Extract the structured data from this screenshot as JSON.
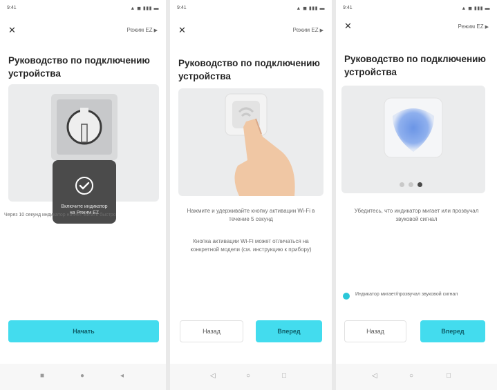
{
  "screens": [
    {
      "status_time": "9:41",
      "status_icons": "▲ ◼ ▮▮▮ ▬",
      "mode_label": "Режим EZ",
      "title": "Руководство по подключению устройства",
      "caption": "Через 10 секунд индикатор начнет мигать быстро",
      "overlay_text": "Включите индикатор на Режим EZ",
      "next_button": "Начать"
    },
    {
      "status_time": "9:41",
      "status_icons": "▲ ◼ ▮▮▮ ▬",
      "mode_label": "Режим EZ",
      "title": "Руководство по подключению устройства",
      "caption_1": "Нажмите и удерживайте кнопку активации Wi-Fi в течение 5 секунд",
      "caption_2": "Кнопка активации Wi-Fi может отличаться на конкретной модели (см. инструкцию к прибору)",
      "back_button": "Назад",
      "next_button": "Вперед"
    },
    {
      "status_time": "9:41",
      "status_icons": "▲ ◼ ▮▮▮ ▬",
      "mode_label": "Режим EZ",
      "title": "Руководство по подключению устройства",
      "caption": "Убедитесь, что индикатор мигает или прозвучал звуковой сигнал",
      "checkbox_label": "Индикатор мигает/прозвучал звуковой сигнал",
      "checkbox_checked": true,
      "pager": {
        "count": 3,
        "active": 3
      },
      "back_button": "Назад",
      "next_button": "Вперед"
    }
  ],
  "nav_icons": [
    "menu-icon",
    "home-icon",
    "back-icon"
  ],
  "colors": {
    "accent": "#43dcee",
    "wifi_glow": "#6b95e6"
  }
}
